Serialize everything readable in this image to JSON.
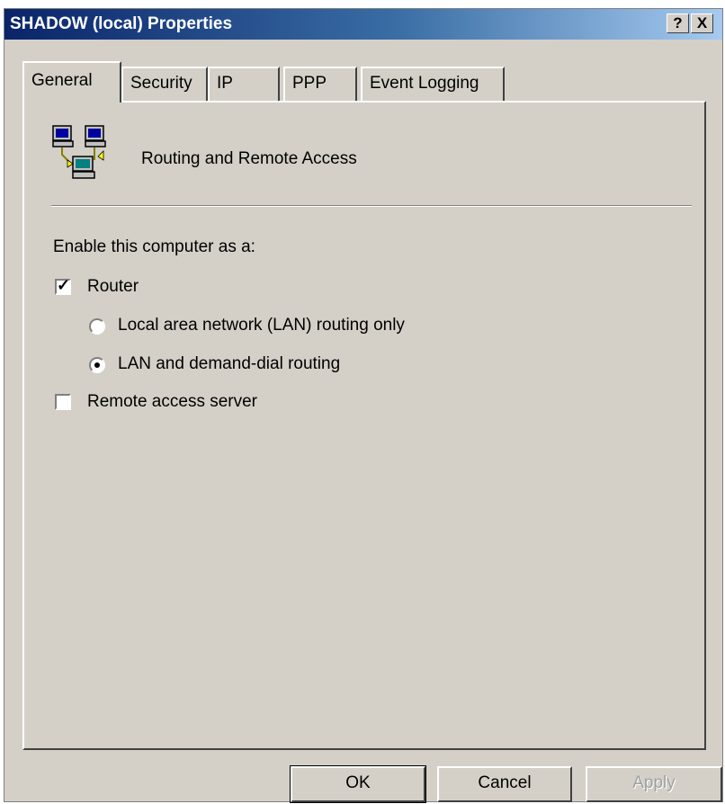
{
  "window": {
    "title": "SHADOW (local) Properties",
    "help_label": "?",
    "close_label": "X"
  },
  "tabs": [
    {
      "label": "General",
      "active": true
    },
    {
      "label": "Security",
      "active": false
    },
    {
      "label": "IP",
      "active": false
    },
    {
      "label": "PPP",
      "active": false
    },
    {
      "label": "Event Logging",
      "active": false
    }
  ],
  "general": {
    "heading": "Routing and Remote Access",
    "enable_label": "Enable this computer as a:",
    "router": {
      "label": "Router",
      "checked": true
    },
    "lan_only": {
      "label": "Local area network (LAN) routing only",
      "selected": false
    },
    "lan_demand": {
      "label": "LAN and demand-dial routing",
      "selected": true
    },
    "remote_access": {
      "label": "Remote access server",
      "checked": false
    }
  },
  "buttons": {
    "ok": "OK",
    "cancel": "Cancel",
    "apply": "Apply"
  },
  "colors": {
    "titlebar_start": "#0a246a",
    "titlebar_end": "#a6caf0",
    "dialog_face": "#d4d0c8"
  }
}
